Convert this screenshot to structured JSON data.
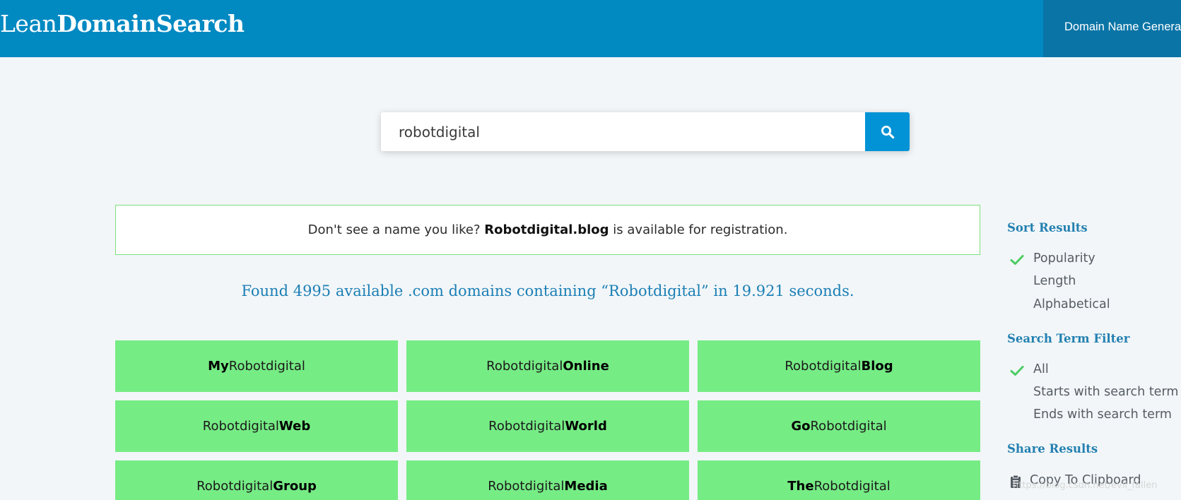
{
  "header": {
    "logo_light": "Lean",
    "logo_bold": "DomainSearch",
    "nav_label": "Domain Name Generat"
  },
  "search": {
    "value": "robotdigital",
    "placeholder": "",
    "button_icon": "search-icon"
  },
  "notice": {
    "prefix": "Don't see a name you like?",
    "domain": "Robotdigital.blog",
    "suffix": "is available for registration."
  },
  "summary": {
    "text": "Found 4995 available .com domains containing “Robotdigital” in 19.921 seconds."
  },
  "results": [
    {
      "pre_bold": "My",
      "pre_plain": "",
      "post_plain": "Robotdigital",
      "post_bold": ""
    },
    {
      "pre_bold": "",
      "pre_plain": "Robotdigital",
      "post_plain": "",
      "post_bold": "Online"
    },
    {
      "pre_bold": "",
      "pre_plain": "Robotdigital",
      "post_plain": "",
      "post_bold": "Blog"
    },
    {
      "pre_bold": "",
      "pre_plain": "Robotdigital",
      "post_plain": "",
      "post_bold": "Web"
    },
    {
      "pre_bold": "",
      "pre_plain": "Robotdigital",
      "post_plain": "",
      "post_bold": "World"
    },
    {
      "pre_bold": "Go",
      "pre_plain": "",
      "post_plain": "Robotdigital",
      "post_bold": ""
    },
    {
      "pre_bold": "",
      "pre_plain": "Robotdigital",
      "post_plain": "",
      "post_bold": "Group"
    },
    {
      "pre_bold": "",
      "pre_plain": "Robotdigital",
      "post_plain": "",
      "post_bold": "Media"
    },
    {
      "pre_bold": "The",
      "pre_plain": "",
      "post_plain": "Robotdigital",
      "post_bold": ""
    }
  ],
  "sidebar": {
    "sort": {
      "heading": "Sort Results",
      "options": [
        {
          "label": "Popularity",
          "selected": true
        },
        {
          "label": "Length",
          "selected": false
        },
        {
          "label": "Alphabetical",
          "selected": false
        }
      ]
    },
    "filter": {
      "heading": "Search Term Filter",
      "options": [
        {
          "label": "All",
          "selected": true
        },
        {
          "label": "Starts with search term",
          "selected": false
        },
        {
          "label": "Ends with search term",
          "selected": false
        }
      ]
    },
    "share": {
      "heading": "Share Results",
      "copy_label": "Copy To Clipboard",
      "copy_icon": "clipboard-icon"
    }
  },
  "watermark": {
    "text": "https://blog.csdn.net/evil_fallen"
  },
  "colors": {
    "header_bg": "#0189c2",
    "nav_tab_bg": "#0a74a6",
    "search_button": "#0293d6",
    "result_bg": "#76ec85",
    "notice_border": "#7be17d",
    "accent_text": "#1b7fb5",
    "check_color": "#4ccc63",
    "page_bg": "#f2f6f8"
  }
}
